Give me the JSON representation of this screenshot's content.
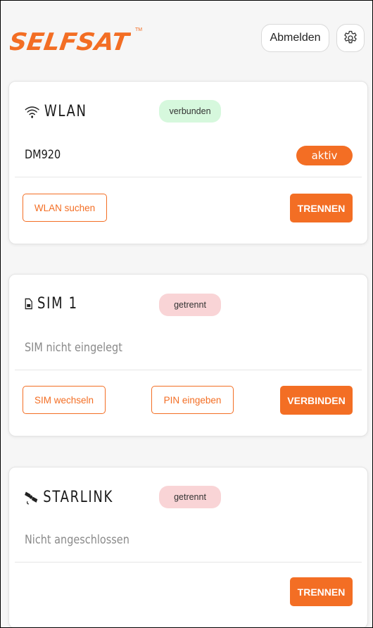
{
  "header": {
    "logo_text": "SELFSAT",
    "logo_tm": "TM",
    "logout_label": "Abmelden",
    "brand_color": "#f36e24"
  },
  "wlan": {
    "title": "WLAN",
    "icon": "wifi-icon",
    "status": "verbunden",
    "network": "DM920",
    "network_state": "aktiv",
    "search_label": "WLAN suchen",
    "disconnect_label": "TRENNEN"
  },
  "sim": {
    "title": "SIM 1",
    "icon": "sim-card-icon",
    "status": "getrennt",
    "info": "SIM nicht eingelegt",
    "switch_label": "SIM wechseln",
    "pin_label": "PIN eingeben",
    "connect_label": "VERBINDEN"
  },
  "starlink": {
    "title": "STARLINK",
    "icon": "satellite-icon",
    "status": "getrennt",
    "info": "Nicht angeschlossen",
    "disconnect_label": "TRENNEN"
  },
  "colors": {
    "accent": "#f36e24",
    "connected_badge": "#d6f8dd",
    "disconnected_badge": "#f9d4d6"
  }
}
